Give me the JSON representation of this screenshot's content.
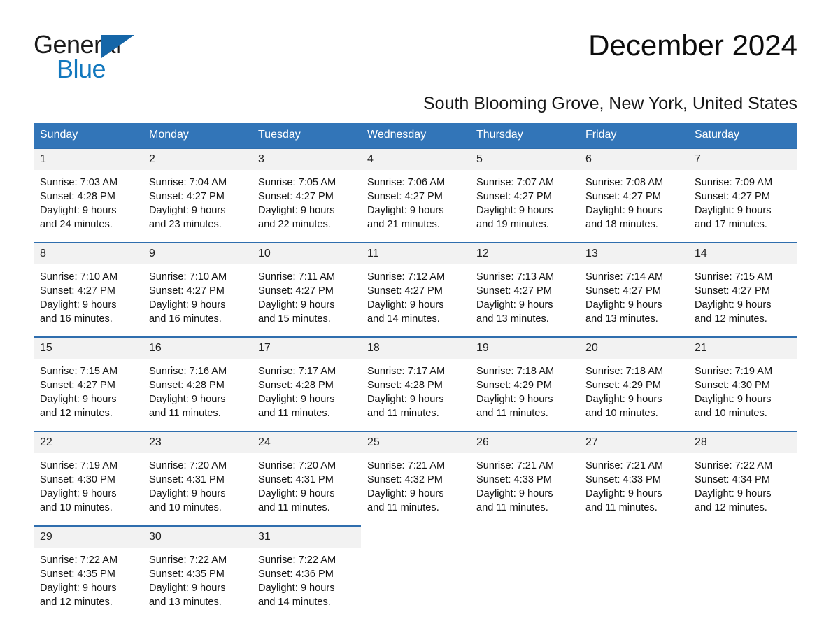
{
  "brand": {
    "name_part1": "General",
    "name_part2": "Blue",
    "triangle_color": "#1566a8",
    "blue_color": "#1278be"
  },
  "header": {
    "month_title": "December 2024",
    "location": "South Blooming Grove, New York, United States"
  },
  "calendar": {
    "header_bg": "#3275b8",
    "header_text_color": "#ffffff",
    "daynum_bg": "#f2f2f2",
    "row_border_color": "#2f6eae",
    "weekdays": [
      "Sunday",
      "Monday",
      "Tuesday",
      "Wednesday",
      "Thursday",
      "Friday",
      "Saturday"
    ],
    "weeks": [
      [
        {
          "day": "1",
          "sunrise": "Sunrise: 7:03 AM",
          "sunset": "Sunset: 4:28 PM",
          "daylight_line1": "Daylight: 9 hours",
          "daylight_line2": "and 24 minutes."
        },
        {
          "day": "2",
          "sunrise": "Sunrise: 7:04 AM",
          "sunset": "Sunset: 4:27 PM",
          "daylight_line1": "Daylight: 9 hours",
          "daylight_line2": "and 23 minutes."
        },
        {
          "day": "3",
          "sunrise": "Sunrise: 7:05 AM",
          "sunset": "Sunset: 4:27 PM",
          "daylight_line1": "Daylight: 9 hours",
          "daylight_line2": "and 22 minutes."
        },
        {
          "day": "4",
          "sunrise": "Sunrise: 7:06 AM",
          "sunset": "Sunset: 4:27 PM",
          "daylight_line1": "Daylight: 9 hours",
          "daylight_line2": "and 21 minutes."
        },
        {
          "day": "5",
          "sunrise": "Sunrise: 7:07 AM",
          "sunset": "Sunset: 4:27 PM",
          "daylight_line1": "Daylight: 9 hours",
          "daylight_line2": "and 19 minutes."
        },
        {
          "day": "6",
          "sunrise": "Sunrise: 7:08 AM",
          "sunset": "Sunset: 4:27 PM",
          "daylight_line1": "Daylight: 9 hours",
          "daylight_line2": "and 18 minutes."
        },
        {
          "day": "7",
          "sunrise": "Sunrise: 7:09 AM",
          "sunset": "Sunset: 4:27 PM",
          "daylight_line1": "Daylight: 9 hours",
          "daylight_line2": "and 17 minutes."
        }
      ],
      [
        {
          "day": "8",
          "sunrise": "Sunrise: 7:10 AM",
          "sunset": "Sunset: 4:27 PM",
          "daylight_line1": "Daylight: 9 hours",
          "daylight_line2": "and 16 minutes."
        },
        {
          "day": "9",
          "sunrise": "Sunrise: 7:10 AM",
          "sunset": "Sunset: 4:27 PM",
          "daylight_line1": "Daylight: 9 hours",
          "daylight_line2": "and 16 minutes."
        },
        {
          "day": "10",
          "sunrise": "Sunrise: 7:11 AM",
          "sunset": "Sunset: 4:27 PM",
          "daylight_line1": "Daylight: 9 hours",
          "daylight_line2": "and 15 minutes."
        },
        {
          "day": "11",
          "sunrise": "Sunrise: 7:12 AM",
          "sunset": "Sunset: 4:27 PM",
          "daylight_line1": "Daylight: 9 hours",
          "daylight_line2": "and 14 minutes."
        },
        {
          "day": "12",
          "sunrise": "Sunrise: 7:13 AM",
          "sunset": "Sunset: 4:27 PM",
          "daylight_line1": "Daylight: 9 hours",
          "daylight_line2": "and 13 minutes."
        },
        {
          "day": "13",
          "sunrise": "Sunrise: 7:14 AM",
          "sunset": "Sunset: 4:27 PM",
          "daylight_line1": "Daylight: 9 hours",
          "daylight_line2": "and 13 minutes."
        },
        {
          "day": "14",
          "sunrise": "Sunrise: 7:15 AM",
          "sunset": "Sunset: 4:27 PM",
          "daylight_line1": "Daylight: 9 hours",
          "daylight_line2": "and 12 minutes."
        }
      ],
      [
        {
          "day": "15",
          "sunrise": "Sunrise: 7:15 AM",
          "sunset": "Sunset: 4:27 PM",
          "daylight_line1": "Daylight: 9 hours",
          "daylight_line2": "and 12 minutes."
        },
        {
          "day": "16",
          "sunrise": "Sunrise: 7:16 AM",
          "sunset": "Sunset: 4:28 PM",
          "daylight_line1": "Daylight: 9 hours",
          "daylight_line2": "and 11 minutes."
        },
        {
          "day": "17",
          "sunrise": "Sunrise: 7:17 AM",
          "sunset": "Sunset: 4:28 PM",
          "daylight_line1": "Daylight: 9 hours",
          "daylight_line2": "and 11 minutes."
        },
        {
          "day": "18",
          "sunrise": "Sunrise: 7:17 AM",
          "sunset": "Sunset: 4:28 PM",
          "daylight_line1": "Daylight: 9 hours",
          "daylight_line2": "and 11 minutes."
        },
        {
          "day": "19",
          "sunrise": "Sunrise: 7:18 AM",
          "sunset": "Sunset: 4:29 PM",
          "daylight_line1": "Daylight: 9 hours",
          "daylight_line2": "and 11 minutes."
        },
        {
          "day": "20",
          "sunrise": "Sunrise: 7:18 AM",
          "sunset": "Sunset: 4:29 PM",
          "daylight_line1": "Daylight: 9 hours",
          "daylight_line2": "and 10 minutes."
        },
        {
          "day": "21",
          "sunrise": "Sunrise: 7:19 AM",
          "sunset": "Sunset: 4:30 PM",
          "daylight_line1": "Daylight: 9 hours",
          "daylight_line2": "and 10 minutes."
        }
      ],
      [
        {
          "day": "22",
          "sunrise": "Sunrise: 7:19 AM",
          "sunset": "Sunset: 4:30 PM",
          "daylight_line1": "Daylight: 9 hours",
          "daylight_line2": "and 10 minutes."
        },
        {
          "day": "23",
          "sunrise": "Sunrise: 7:20 AM",
          "sunset": "Sunset: 4:31 PM",
          "daylight_line1": "Daylight: 9 hours",
          "daylight_line2": "and 10 minutes."
        },
        {
          "day": "24",
          "sunrise": "Sunrise: 7:20 AM",
          "sunset": "Sunset: 4:31 PM",
          "daylight_line1": "Daylight: 9 hours",
          "daylight_line2": "and 11 minutes."
        },
        {
          "day": "25",
          "sunrise": "Sunrise: 7:21 AM",
          "sunset": "Sunset: 4:32 PM",
          "daylight_line1": "Daylight: 9 hours",
          "daylight_line2": "and 11 minutes."
        },
        {
          "day": "26",
          "sunrise": "Sunrise: 7:21 AM",
          "sunset": "Sunset: 4:33 PM",
          "daylight_line1": "Daylight: 9 hours",
          "daylight_line2": "and 11 minutes."
        },
        {
          "day": "27",
          "sunrise": "Sunrise: 7:21 AM",
          "sunset": "Sunset: 4:33 PM",
          "daylight_line1": "Daylight: 9 hours",
          "daylight_line2": "and 11 minutes."
        },
        {
          "day": "28",
          "sunrise": "Sunrise: 7:22 AM",
          "sunset": "Sunset: 4:34 PM",
          "daylight_line1": "Daylight: 9 hours",
          "daylight_line2": "and 12 minutes."
        }
      ],
      [
        {
          "day": "29",
          "sunrise": "Sunrise: 7:22 AM",
          "sunset": "Sunset: 4:35 PM",
          "daylight_line1": "Daylight: 9 hours",
          "daylight_line2": "and 12 minutes."
        },
        {
          "day": "30",
          "sunrise": "Sunrise: 7:22 AM",
          "sunset": "Sunset: 4:35 PM",
          "daylight_line1": "Daylight: 9 hours",
          "daylight_line2": "and 13 minutes."
        },
        {
          "day": "31",
          "sunrise": "Sunrise: 7:22 AM",
          "sunset": "Sunset: 4:36 PM",
          "daylight_line1": "Daylight: 9 hours",
          "daylight_line2": "and 14 minutes."
        },
        {
          "day": "",
          "sunrise": "",
          "sunset": "",
          "daylight_line1": "",
          "daylight_line2": ""
        },
        {
          "day": "",
          "sunrise": "",
          "sunset": "",
          "daylight_line1": "",
          "daylight_line2": ""
        },
        {
          "day": "",
          "sunrise": "",
          "sunset": "",
          "daylight_line1": "",
          "daylight_line2": ""
        },
        {
          "day": "",
          "sunrise": "",
          "sunset": "",
          "daylight_line1": "",
          "daylight_line2": ""
        }
      ]
    ]
  }
}
